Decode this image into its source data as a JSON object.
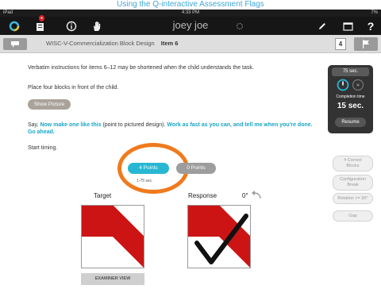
{
  "caption": "Using the Q-interactive Assessment Flags",
  "statusbar": {
    "left": "iPad",
    "time": "4:33 PM",
    "right": "7%"
  },
  "appbar": {
    "title": "joey joe"
  },
  "subbar": {
    "test": "WISC-V-Commercialization Block Design",
    "item": "Item 6",
    "item_number": "4"
  },
  "instructions": {
    "verbatim": "Verbatim instructions for items 6–12 may be shortened when the child understands the task.",
    "place": "Place four blocks in front of the child.",
    "show_picture": "Show Picture",
    "say_prefix": "Say,",
    "say_1": "Now make one like this",
    "say_mid": "(point to pictured design).",
    "say_2": "Work as fast as you can, and tell me when you're done. Go ahead.",
    "start": "Start timing."
  },
  "scoring": {
    "points_4": "4 Points",
    "points_0": "0 Points",
    "time_range": "1-75 sec."
  },
  "timer": {
    "time_limit": "75 sec.",
    "completion_label": "Completion time",
    "completion_value": "15 sec.",
    "resume": "Resume"
  },
  "side_buttons": [
    "# Correct Blocks",
    "Configuration Break",
    "Rotation >= 30°",
    "Gap"
  ],
  "designs": {
    "target_label": "Target",
    "response_label": "Response",
    "rotation": "0°"
  },
  "examiner_view": "EXAMINER VIEW",
  "colors": {
    "accent": "#17a6c4",
    "block_red": "#cc1414",
    "highlight": "#f07a1c"
  },
  "icons": [
    "refresh-icon",
    "clipboard-icon",
    "info-icon",
    "hand-icon",
    "activity-icon",
    "pencil-icon",
    "window-icon",
    "help-icon",
    "flag-icon",
    "rotate-icon"
  ]
}
